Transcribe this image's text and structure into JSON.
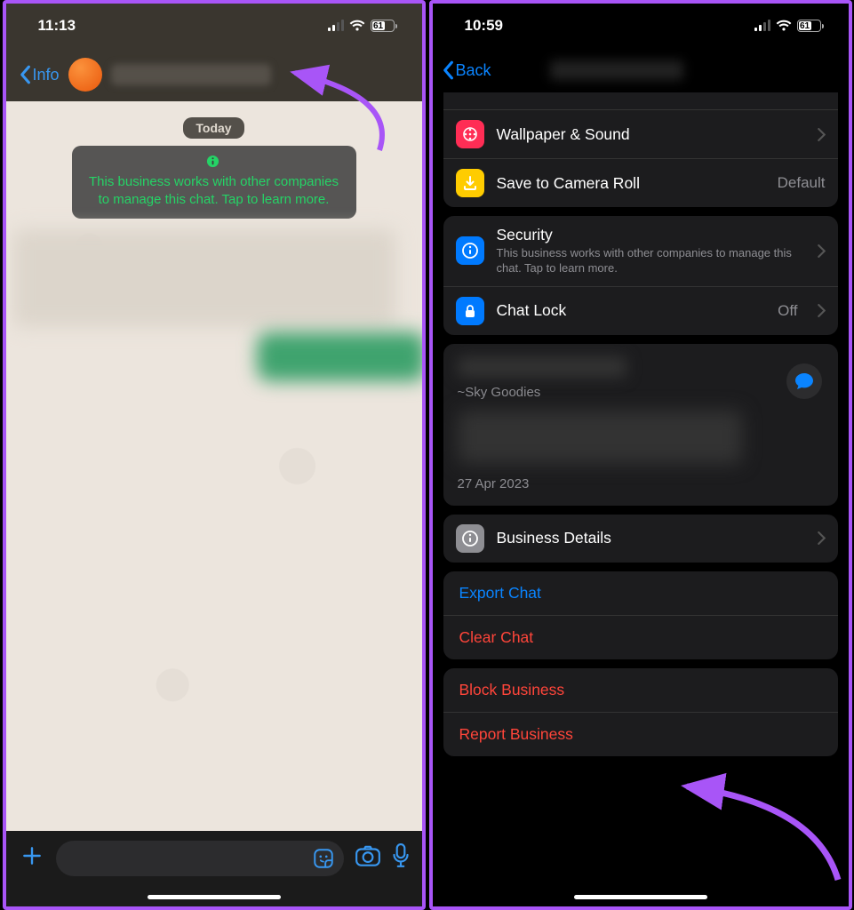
{
  "left": {
    "time": "11:13",
    "battery": "61",
    "battery_pct": 61,
    "back_label": "Info",
    "date_label": "Today",
    "info_notice": "This business works with other companies to manage this chat. Tap to learn more."
  },
  "right": {
    "time": "10:59",
    "battery": "61",
    "battery_pct": 61,
    "back_label": "Back",
    "rows": {
      "wallpaper": "Wallpaper & Sound",
      "save_roll": "Save to Camera Roll",
      "save_roll_val": "Default",
      "security": "Security",
      "security_sub": "This business works with other companies to manage this chat. Tap to learn more.",
      "chat_lock": "Chat Lock",
      "chat_lock_val": "Off",
      "business_details": "Business Details"
    },
    "contact": {
      "sub": "~Sky Goodies",
      "date": "27 Apr 2023"
    },
    "actions": {
      "export": "Export Chat",
      "clear": "Clear Chat",
      "block": "Block Business",
      "report": "Report Business"
    }
  }
}
